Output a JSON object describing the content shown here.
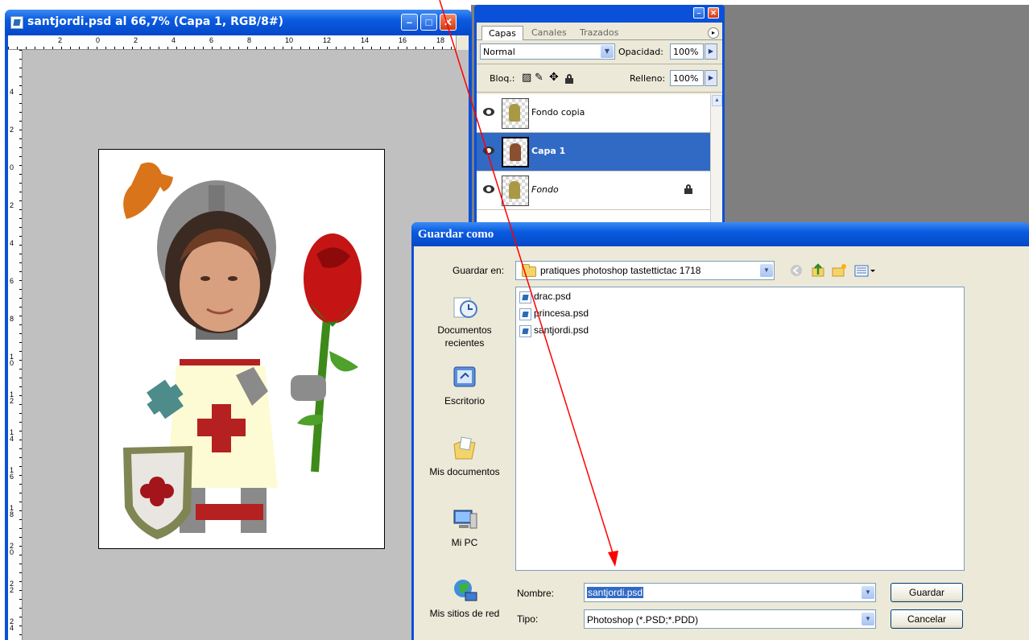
{
  "document": {
    "title": "santjordi.psd al 66,7% (Capa 1, RGB/8#)",
    "hruler_labels": [
      "2",
      "0",
      "2",
      "4",
      "6",
      "8",
      "10",
      "12",
      "14",
      "16",
      "18"
    ],
    "vruler_labels": [
      "4",
      "2",
      "0",
      "2",
      "4",
      "6",
      "8",
      "10",
      "12",
      "14",
      "16",
      "18",
      "20",
      "22",
      "24"
    ]
  },
  "layers_palette": {
    "tabs": [
      "Capas",
      "Canales",
      "Trazados"
    ],
    "blend_mode": "Normal",
    "opacity_label": "Opacidad:",
    "opacity_value": "100%",
    "lock_label": "Bloq.:",
    "fill_label": "Relleno:",
    "fill_value": "100%",
    "layers": [
      {
        "name": "Fondo copia",
        "selected": false,
        "locked": false
      },
      {
        "name": "Capa 1",
        "selected": true,
        "locked": false
      },
      {
        "name": "Fondo",
        "selected": false,
        "locked": true
      }
    ]
  },
  "save_dialog": {
    "title": "Guardar como",
    "save_in_label": "Guardar en:",
    "save_in_value": "pratiques photoshop tastettictac 1718",
    "places": [
      {
        "label": "Documentos recientes",
        "icon": "recent-documents-icon"
      },
      {
        "label": "Escritorio",
        "icon": "desktop-icon"
      },
      {
        "label": "Mis documentos",
        "icon": "my-documents-icon"
      },
      {
        "label": "Mi PC",
        "icon": "my-computer-icon"
      },
      {
        "label": "Mis sitios de red",
        "icon": "network-places-icon"
      }
    ],
    "files": [
      "drac.psd",
      "princesa.psd",
      "santjordi.psd"
    ],
    "name_label": "Nombre:",
    "name_value": "santjordi.psd",
    "type_label": "Tipo:",
    "type_value": "Photoshop (*.PSD;*.PDD)",
    "save_button": "Guardar",
    "cancel_button": "Cancelar"
  },
  "colors": {
    "titlebar": "#0a5be0",
    "selection": "#316ac5",
    "annotation_arrow": "#ff0000"
  }
}
